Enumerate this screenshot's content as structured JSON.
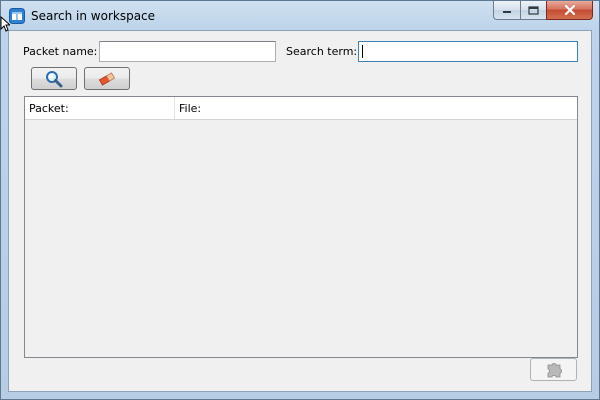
{
  "window": {
    "title": "Search in workspace",
    "icons": {
      "app": "workspace-app-icon",
      "minimize": "minimize-icon",
      "maximize": "maximize-icon",
      "close": "close-icon"
    }
  },
  "form": {
    "packet_name_label": "Packet name:",
    "packet_name_value": "",
    "search_term_label": "Search term:",
    "search_term_value": ""
  },
  "toolbar": {
    "search_icon": "magnifier-icon",
    "clear_icon": "eraser-icon"
  },
  "results": {
    "columns": [
      "Packet:",
      "File:"
    ],
    "rows": []
  },
  "footer": {
    "action_icon": "puzzle-icon",
    "action_enabled": false
  },
  "colors": {
    "titlebar": "#bcd3ea",
    "client_bg": "#f0f0f0",
    "close_button": "#c44b32"
  }
}
